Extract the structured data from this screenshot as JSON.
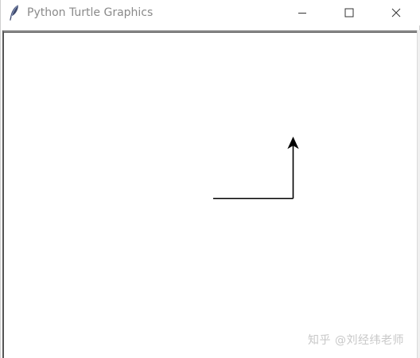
{
  "window": {
    "title": "Python Turtle Graphics",
    "icon": "tk-feather-icon",
    "controls": {
      "minimize_icon": "minimize-icon",
      "maximize_icon": "maximize-icon",
      "close_icon": "close-icon"
    }
  },
  "canvas": {
    "background": "#ffffff",
    "pen_color": "#000000",
    "turtle": {
      "shape": "arrow",
      "heading_deg": 90
    }
  },
  "watermark": {
    "text": "知乎 @刘经纬老师"
  }
}
